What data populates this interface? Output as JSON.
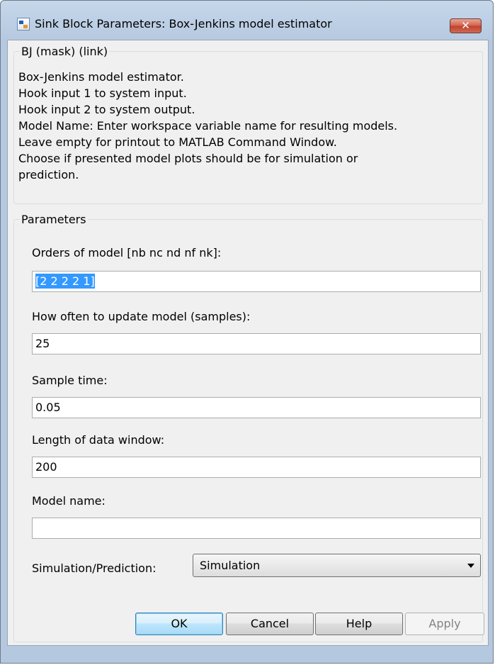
{
  "window": {
    "title": "Sink Block Parameters: Box-Jenkins model estimator",
    "close_label": "✕"
  },
  "description": {
    "legend": "BJ (mask) (link)",
    "lines": [
      "Box-Jenkins model estimator.",
      "Hook input 1 to system input.",
      "Hook input 2 to system output.",
      "Model Name: Enter workspace variable name for resulting models.",
      "Leave empty for printout to MATLAB Command Window.",
      "Choose if presented model plots should be for simulation or prediction."
    ]
  },
  "parameters": {
    "legend": "Parameters",
    "orders_label": "Orders of model [nb nc nd nf nk]:",
    "orders_value": "[2 2 2 2 1]",
    "update_label": "How often to update model (samples):",
    "update_value": "25",
    "sample_time_label": "Sample time:",
    "sample_time_value": "0.05",
    "window_length_label": "Length of data window:",
    "window_length_value": "200",
    "model_name_label": "Model name:",
    "model_name_value": "",
    "mode_label": "Simulation/Prediction:",
    "mode_value": "Simulation"
  },
  "buttons": {
    "ok": "OK",
    "cancel": "Cancel",
    "help": "Help",
    "apply": "Apply"
  },
  "icons": {
    "app": "simulink-block-icon",
    "close": "close-icon",
    "dropdown": "chevron-down-icon"
  },
  "colors": {
    "selection": "#3399ff",
    "close_button": "#c7503a",
    "frame": "#b4c8df"
  }
}
